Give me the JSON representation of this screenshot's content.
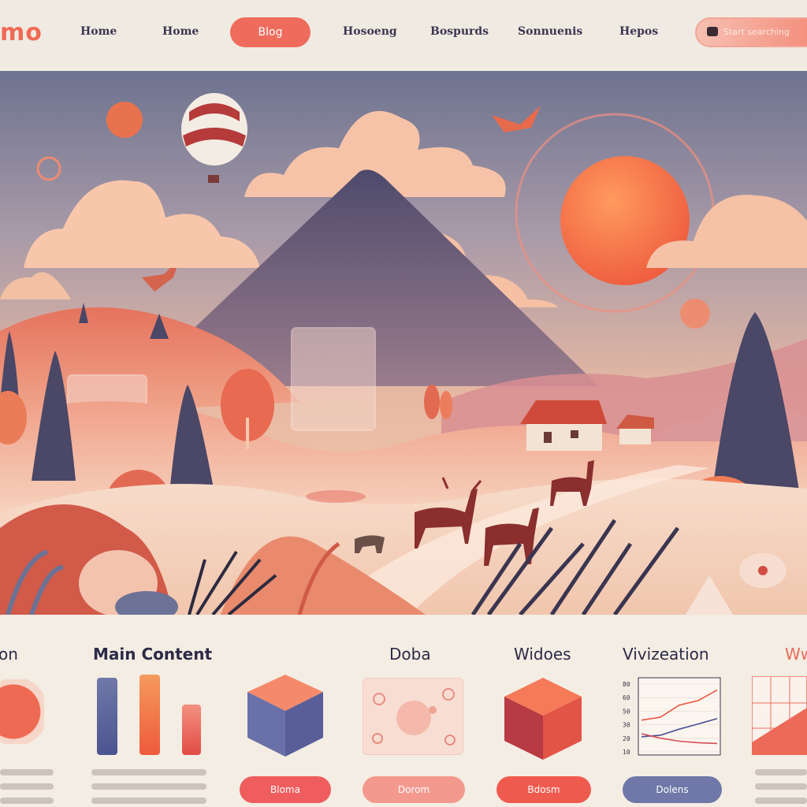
{
  "nav": {
    "logo": "mo",
    "links": [
      "Home",
      "Home",
      "Hosoeng",
      "Bospurds",
      "Sonnuenis",
      "Hepos"
    ],
    "active_pill": "Blog",
    "search_placeholder": "Start searching"
  },
  "sections": {
    "col0_title": "on",
    "col1_title": "Main Content",
    "col2_title": "Doba",
    "col3_title": "Widoes",
    "col4_title": "Vivizeation",
    "col5_title": "Ww"
  },
  "buttons": {
    "btn1": "Bloma",
    "btn2": "Dorom",
    "btn3": "Bdosm",
    "btn4": "Dolens"
  },
  "chart_data": {
    "type": "line",
    "title": "Vivizeation",
    "xlabel": "",
    "ylabel": "",
    "y_ticks": [
      "80",
      "60",
      "50",
      "30",
      "20",
      "10"
    ],
    "series": [
      {
        "values": [
          40,
          44,
          60,
          66,
          80
        ]
      },
      {
        "values": [
          18,
          20,
          28,
          35,
          42
        ]
      },
      {
        "values": [
          22,
          16,
          12,
          10,
          9
        ]
      }
    ]
  },
  "colors": {
    "accent": "#ef6b5c",
    "navy": "#3c3550",
    "blue_button": "#6f78a8"
  }
}
